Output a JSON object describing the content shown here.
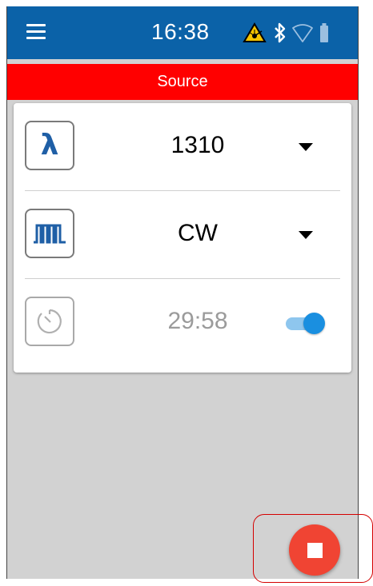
{
  "status_bar": {
    "time": "16:38",
    "icons": [
      "laser-warning-icon",
      "bluetooth-icon",
      "wifi-icon",
      "battery-icon"
    ]
  },
  "header": {
    "menu_icon": "hamburger-menu-icon",
    "title": "Source"
  },
  "source_card": {
    "wavelength": {
      "icon": "lambda-icon",
      "icon_glyph": "λ",
      "value": "1310",
      "control": "dropdown"
    },
    "modulation": {
      "icon": "pulse-wave-icon",
      "value": "CW",
      "control": "dropdown"
    },
    "timer": {
      "icon": "timer-icon",
      "value": "29:58",
      "enabled": true
    }
  },
  "actions": {
    "stop_icon": "stop-icon"
  },
  "colors": {
    "topbar": "#0b62a8",
    "title_bar": "#ff0000",
    "background": "#d2d2d2",
    "accent": "#1a8fe0",
    "stop_button": "#f04433"
  }
}
